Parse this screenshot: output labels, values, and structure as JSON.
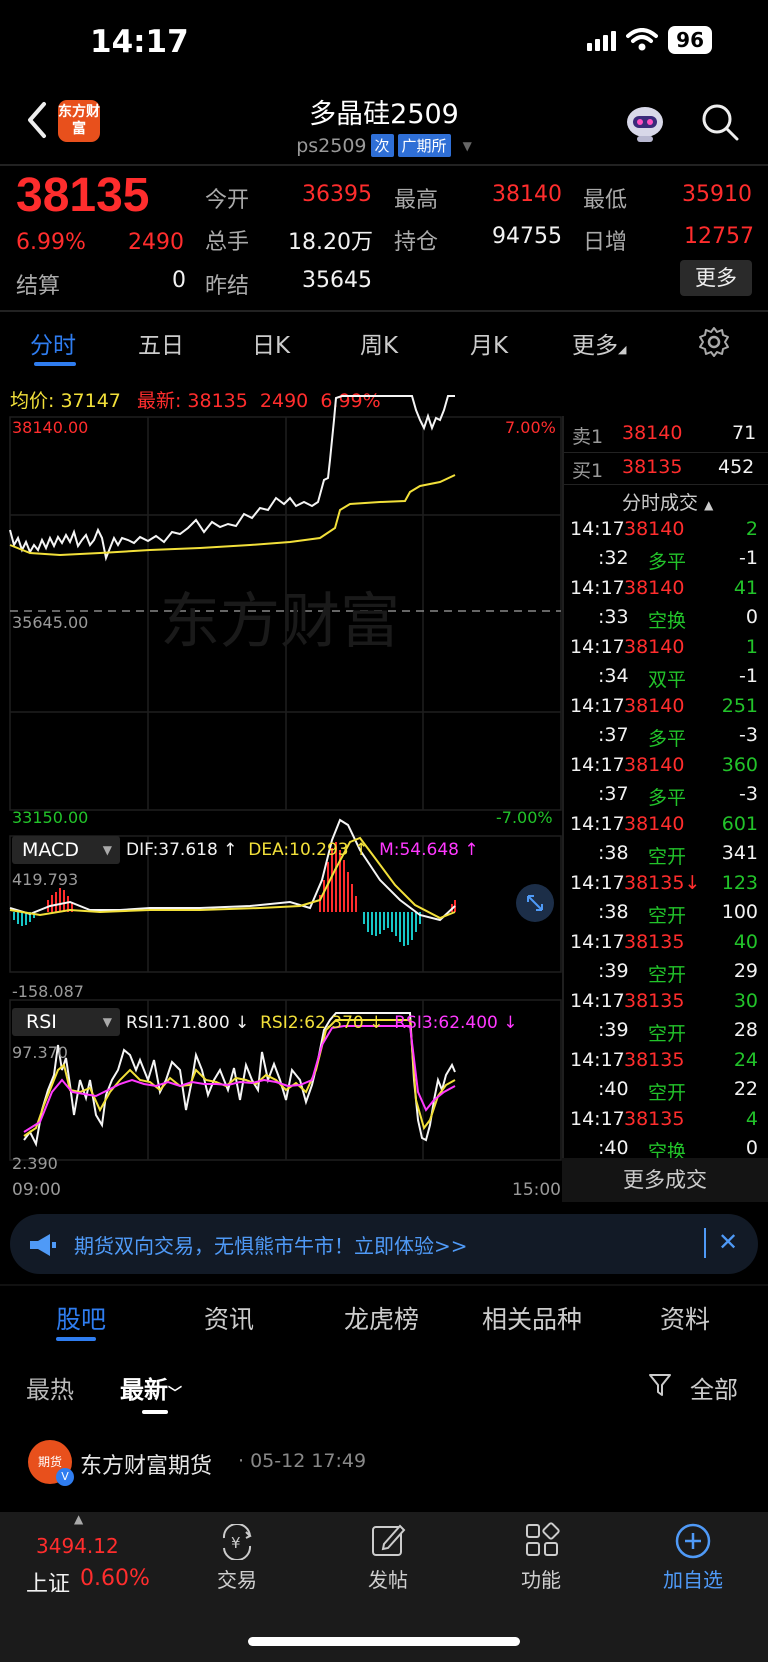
{
  "status_bar": {
    "time": "14:17",
    "battery": "96"
  },
  "header": {
    "logo_text": "东方财富",
    "title": "多晶硅2509",
    "code": "ps2509",
    "badge_next": "次",
    "exchange": "广期所"
  },
  "quote": {
    "last_price": "38135",
    "change_pct": "6.99%",
    "change": "2490",
    "settle_label": "结算",
    "settle_value": "0",
    "fields": [
      {
        "label": "今开",
        "value": "36395"
      },
      {
        "label": "最高",
        "value": "38140"
      },
      {
        "label": "最低",
        "value": "35910"
      },
      {
        "label": "总手",
        "value": "18.20万"
      },
      {
        "label": "持仓",
        "value": "94755"
      },
      {
        "label": "日增",
        "value": "12757"
      },
      {
        "label": "昨结",
        "value": "35645"
      }
    ],
    "more_button": "更多"
  },
  "chart_tabs": [
    "分时",
    "五日",
    "日K",
    "周K",
    "月K",
    "更多"
  ],
  "intraday": {
    "avg_label": "均价:",
    "avg_value": "37147",
    "latest_label": "最新:",
    "latest_value": "38135",
    "latest_change": "2490",
    "latest_pct": "6.99%",
    "y_top": "38140.00",
    "y_mid": "35645.00",
    "y_bottom": "33150.00",
    "pct_top": "7.00%",
    "pct_bottom": "-7.00%",
    "time_start": "09:00",
    "time_end": "15:00",
    "watermark": "东方财富"
  },
  "macd": {
    "selector": "MACD",
    "dif": "DIF:37.618 ↑",
    "dea": "DEA:10.293 ↑",
    "m": "M:54.648 ↑",
    "max": "419.793",
    "min": "-158.087"
  },
  "rsi": {
    "selector": "RSI",
    "rsi1": "RSI1:71.800 ↓",
    "rsi2": "RSI2:62.370 ↓",
    "rsi3": "RSI3:62.400 ↓",
    "max": "97.370",
    "min": "2.390"
  },
  "order_book": {
    "sell1_label": "卖1",
    "sell1_price": "38140",
    "sell1_vol": "71",
    "buy1_label": "买1",
    "buy1_price": "38135",
    "buy1_vol": "452"
  },
  "trades_header": "分时成交",
  "trades": [
    {
      "time": "14:17",
      "price": "38140",
      "vol": "2",
      "sec": ":32",
      "kind": "多平",
      "oi": "-1"
    },
    {
      "time": "14:17",
      "price": "38140",
      "vol": "41",
      "sec": ":33",
      "kind": "空换",
      "oi": "0"
    },
    {
      "time": "14:17",
      "price": "38140",
      "vol": "1",
      "sec": ":34",
      "kind": "双平",
      "oi": "-1"
    },
    {
      "time": "14:17",
      "price": "38140",
      "vol": "251",
      "sec": ":37",
      "kind": "多平",
      "oi": "-3"
    },
    {
      "time": "14:17",
      "price": "38140",
      "vol": "360",
      "sec": ":37",
      "kind": "多平",
      "oi": "-3"
    },
    {
      "time": "14:17",
      "price": "38140",
      "vol": "601",
      "sec": ":38",
      "kind": "空开",
      "oi": "341"
    },
    {
      "time": "14:17",
      "price": "38135↓",
      "vol": "123",
      "sec": ":38",
      "kind": "空开",
      "oi": "100"
    },
    {
      "time": "14:17",
      "price": "38135",
      "vol": "40",
      "sec": ":39",
      "kind": "空开",
      "oi": "29"
    },
    {
      "time": "14:17",
      "price": "38135",
      "vol": "30",
      "sec": ":39",
      "kind": "空开",
      "oi": "28"
    },
    {
      "time": "14:17",
      "price": "38135",
      "vol": "24",
      "sec": ":40",
      "kind": "空开",
      "oi": "22"
    },
    {
      "time": "14:17",
      "price": "38135",
      "vol": "4",
      "sec": ":40",
      "kind": "空换",
      "oi": "0"
    }
  ],
  "more_trades": "更多成交",
  "banner": {
    "text": "期货双向交易，无惧熊市牛市！立即体验>>"
  },
  "section_tabs": [
    "股吧",
    "资讯",
    "龙虎榜",
    "相关品种",
    "资料"
  ],
  "filter": {
    "hot": "最热",
    "latest": "最新",
    "all": "全部"
  },
  "post": {
    "author": "东方财富期货",
    "time": "· 05-12 17:49",
    "avatar_text": "期货"
  },
  "bottom_nav": {
    "index_value": "3494.12",
    "index_name": "上证",
    "index_pct": "0.60%",
    "items": [
      "交易",
      "发帖",
      "功能",
      "加自选"
    ]
  },
  "colors": {
    "up": "#ff2d2d",
    "down": "#22c32a",
    "accent": "#2f7df0",
    "avg": "#f2e03a"
  }
}
